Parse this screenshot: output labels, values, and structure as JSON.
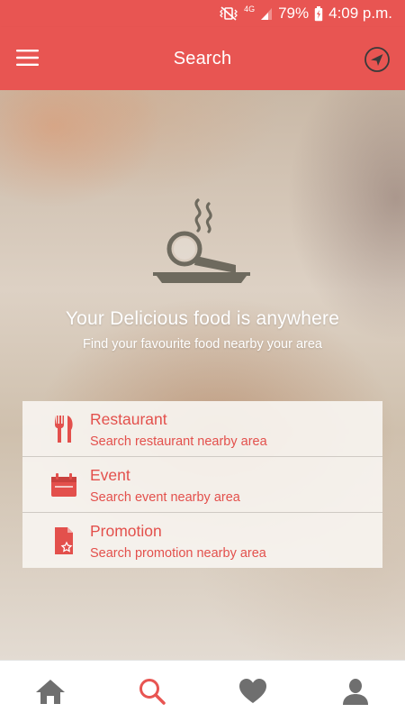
{
  "status_bar": {
    "battery_percent": "79%",
    "time": "4:09 p.m.",
    "network": "4G",
    "icons": [
      "vibrate-mute-icon",
      "network-4g-icon",
      "signal-icon",
      "battery-charging-icon"
    ]
  },
  "app_bar": {
    "title": "Search",
    "left_icon": "menu-icon",
    "right_icon": "locate-icon"
  },
  "hero": {
    "logo_icon": "food-search-icon",
    "headline": "Your Delicious food is anywhere",
    "subline": "Find your favourite food nearby your area"
  },
  "options": [
    {
      "icon": "cutlery-icon",
      "title": "Restaurant",
      "subtitle": "Search restaurant nearby area"
    },
    {
      "icon": "calendar-icon",
      "title": "Event",
      "subtitle": "Search event nearby area"
    },
    {
      "icon": "promotion-icon",
      "title": "Promotion",
      "subtitle": "Search promotion nearby area"
    }
  ],
  "bottom_nav": {
    "items": [
      "home-icon",
      "search-icon",
      "heart-icon",
      "profile-icon"
    ],
    "active": "search-icon"
  },
  "colors": {
    "accent": "#e85552",
    "option_text": "#e3504c",
    "nav_inactive": "#6f6f6f"
  }
}
